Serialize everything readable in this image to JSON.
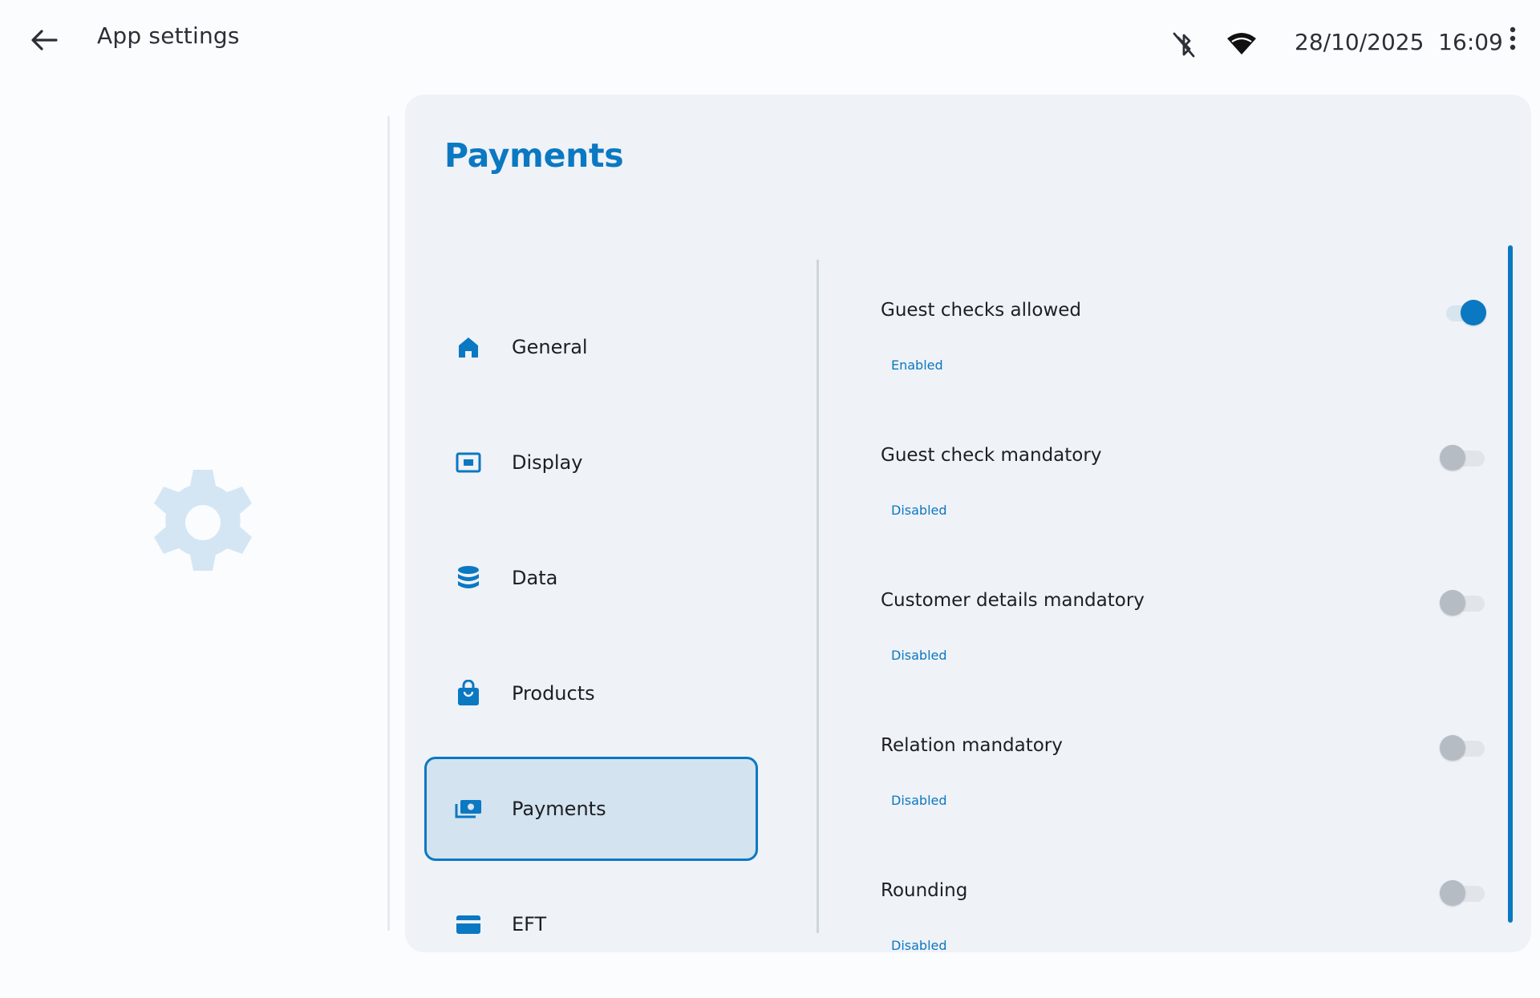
{
  "header": {
    "title": "App settings",
    "datetime": "28/10/2025  16:09",
    "icons": [
      "back-arrow-icon",
      "bluetooth-disabled-icon",
      "wifi-icon",
      "more-vertical-icon"
    ]
  },
  "colors": {
    "accent": "#0b78c2",
    "card_bg": "#eff2f7",
    "active_bg": "#d3e3ef",
    "gear": "#d4e6f3"
  },
  "page": {
    "title": "Payments"
  },
  "nav": {
    "items": [
      {
        "label": "General",
        "icon": "home-icon",
        "active": false
      },
      {
        "label": "Display",
        "icon": "display-icon",
        "active": false
      },
      {
        "label": "Data",
        "icon": "database-icon",
        "active": false
      },
      {
        "label": "Products",
        "icon": "shopping-bag-icon",
        "active": false
      },
      {
        "label": "Payments",
        "icon": "payments-icon",
        "active": true
      },
      {
        "label": "EFT",
        "icon": "card-icon",
        "active": false
      }
    ]
  },
  "settings": {
    "items": [
      {
        "title": "Guest checks allowed",
        "status": "Enabled",
        "on": true
      },
      {
        "title": "Guest check mandatory",
        "status": "Disabled",
        "on": false
      },
      {
        "title": "Customer details mandatory",
        "status": "Disabled",
        "on": false
      },
      {
        "title": "Relation mandatory",
        "status": "Disabled",
        "on": false
      },
      {
        "title": "Rounding",
        "status": "Disabled",
        "on": false
      }
    ]
  }
}
